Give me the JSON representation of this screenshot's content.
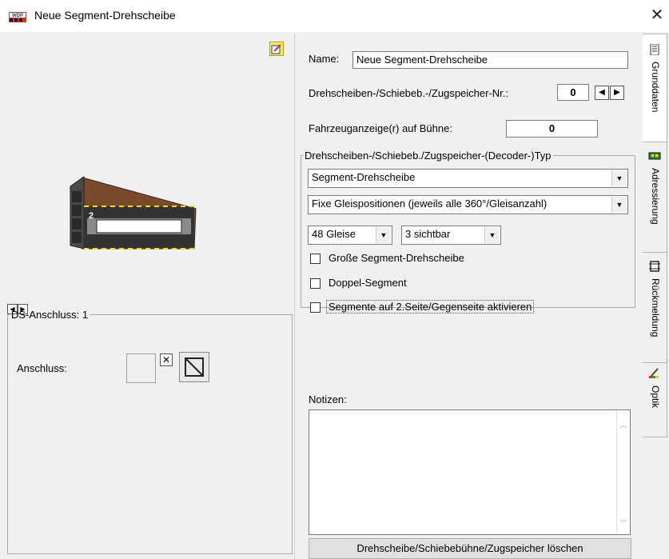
{
  "window": {
    "title": "Neue Segment-Drehscheibe",
    "app_icon": "wdp-app-icon",
    "close": "✕"
  },
  "left": {
    "preview_number": "2",
    "ds_group": {
      "legend": "DS-Anschluss: 1",
      "anschluss_label": "Anschluss:",
      "x_mark": "✕"
    }
  },
  "form": {
    "name_label": "Name:",
    "name_value": "Neue Segment-Drehscheibe",
    "nr_label": "Drehscheiben-/Schiebeb.-/Zugspeicher-Nr.:",
    "nr_value": "0",
    "vehicle_label": "Fahrzeuganzeige(r) auf Bühne:",
    "vehicle_value": "0",
    "type_group": {
      "legend": "Drehscheiben-/Schiebeb./Zugspeicher-(Decoder-)Typ",
      "type_select": "Segment-Drehscheibe",
      "position_select": "Fixe Gleispositionen (jeweils alle 360°/Gleisanzahl)",
      "tracks_select": "48 Gleise",
      "visible_select": "3 sichtbar",
      "cb_large": "Große Segment-Drehscheibe",
      "cb_double": "Doppel-Segment",
      "cb_second_side": "Segmente auf 2.Seite/Gegenseite aktivieren"
    },
    "notes_label": "Notizen:",
    "notes_value": "",
    "delete_button": "Drehscheibe/Schiebebühne/Zugspeicher löschen"
  },
  "tabs": [
    {
      "label": "Grunddaten",
      "icon": "document-icon",
      "active": true
    },
    {
      "label": "Adressierung",
      "icon": "decoder-icon",
      "active": false
    },
    {
      "label": "Rückmeldung",
      "icon": "sensor-icon",
      "active": false
    },
    {
      "label": "Optik",
      "icon": "brush-icon",
      "active": false
    }
  ],
  "colors": {
    "accent_yellow": "#f6e96b",
    "turntable_brown": "#7a4a2c",
    "track_grey": "#3a3a3a"
  }
}
